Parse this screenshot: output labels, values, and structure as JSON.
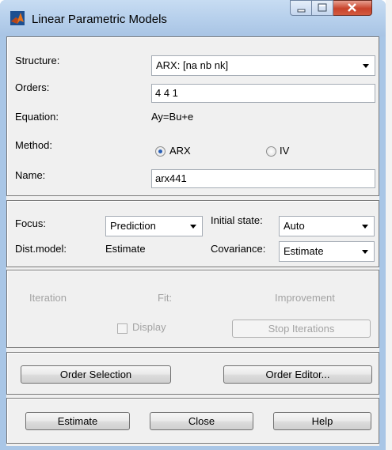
{
  "window": {
    "title": "Linear Parametric Models"
  },
  "model": {
    "structure_label": "Structure:",
    "structure_value": "ARX: [na nb nk]",
    "orders_label": "Orders:",
    "orders_value": "4 4 1",
    "equation_label": "Equation:",
    "equation_value": "Ay=Bu+e",
    "method_label": "Method:",
    "method_options": [
      {
        "label": "ARX",
        "selected": true
      },
      {
        "label": "IV",
        "selected": false
      }
    ],
    "name_label": "Name:",
    "name_value": "arx441"
  },
  "options": {
    "focus_label": "Focus:",
    "focus_value": "Prediction",
    "initial_state_label": "Initial state:",
    "initial_state_value": "Auto",
    "dist_model_label": "Dist.model:",
    "dist_model_value": "Estimate",
    "covariance_label": "Covariance:",
    "covariance_value": "Estimate"
  },
  "iteration": {
    "iteration_label": "Iteration",
    "fit_label": "Fit:",
    "improvement_label": "Improvement",
    "display_label": "Display",
    "display_checked": false,
    "stop_label": "Stop Iterations"
  },
  "order_buttons": {
    "selection_label": "Order Selection",
    "editor_label": "Order Editor..."
  },
  "actions": {
    "estimate_label": "Estimate",
    "close_label": "Close",
    "help_label": "Help"
  }
}
